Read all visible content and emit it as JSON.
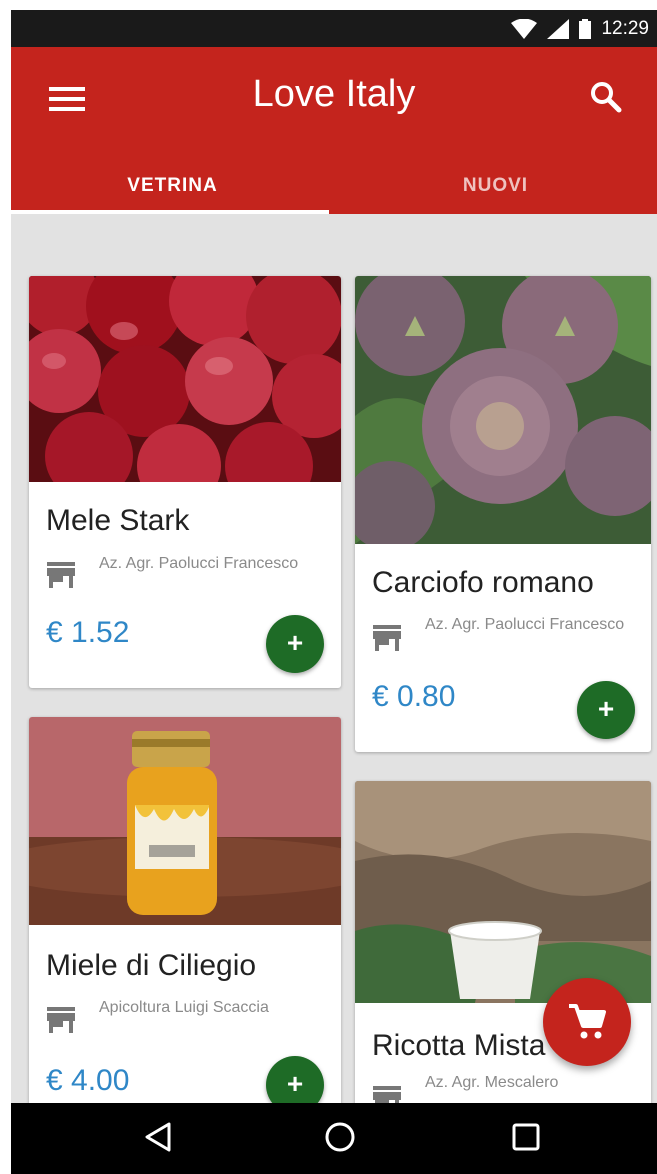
{
  "status_bar": {
    "time": "12:29",
    "icons": [
      "wifi-icon",
      "cell-signal-icon",
      "battery-icon"
    ]
  },
  "app_bar": {
    "title": "Love Italy",
    "menu_icon": "menu-icon",
    "search_icon": "search-icon"
  },
  "tabs": [
    {
      "label": "VETRINA",
      "active": true
    },
    {
      "label": "NUOVI",
      "active": false
    }
  ],
  "products": [
    {
      "name": "Mele Stark",
      "vendor": "Az. Agr. Paolucci Francesco",
      "price": "€ 1.52",
      "image": "red apples"
    },
    {
      "name": "Carciofo romano",
      "vendor": "Az. Agr. Paolucci Francesco",
      "price": "€ 0.80",
      "image": "artichokes"
    },
    {
      "name": "Miele di Ciliegio",
      "vendor": "Apicoltura Luigi Scaccia",
      "price": "€ 4.00",
      "image": "honey jar"
    },
    {
      "name": "Ricotta Mista",
      "vendor": "Az. Agr. Mescalero",
      "price": "",
      "image": "ricotta cup"
    }
  ],
  "add_button_label": "+",
  "cart_fab_icon": "shopping-cart-icon",
  "colors": {
    "primary": "#c4241d",
    "add_button": "#1e6b26",
    "price": "#2f87c7",
    "background": "#e2e2e2"
  },
  "nav_bar": {
    "icons": [
      "back-icon",
      "home-icon",
      "recents-icon"
    ]
  }
}
